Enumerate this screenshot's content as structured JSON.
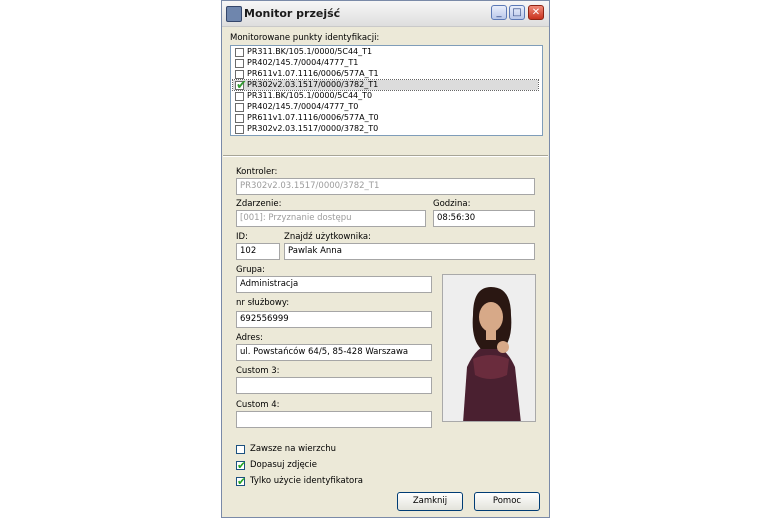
{
  "window": {
    "title": "Monitor przejść"
  },
  "monitored": {
    "label": "Monitorowane punkty identyfikacji:",
    "items": [
      {
        "text": "PR311.BK/105.1/0000/5C44_T1",
        "checked": false,
        "selected": false
      },
      {
        "text": "PR402/145.7/0004/4777_T1",
        "checked": false,
        "selected": false
      },
      {
        "text": "PR611v1.07.1116/0006/577A_T1",
        "checked": false,
        "selected": false
      },
      {
        "text": "PR302v2.03.1517/0000/3782_T1",
        "checked": true,
        "selected": true
      },
      {
        "text": "PR311.BK/105.1/0000/5C44_T0",
        "checked": false,
        "selected": false
      },
      {
        "text": "PR402/145.7/0004/4777_T0",
        "checked": false,
        "selected": false
      },
      {
        "text": "PR611v1.07.1116/0006/577A_T0",
        "checked": false,
        "selected": false
      },
      {
        "text": "PR302v2.03.1517/0000/3782_T0",
        "checked": false,
        "selected": false
      }
    ]
  },
  "details": {
    "kontroler": {
      "label": "Kontroler:",
      "value": "PR302v2.03.1517/0000/3782_T1"
    },
    "zdarzenie": {
      "label": "Zdarzenie:",
      "value": "[001]: Przyznanie dostępu"
    },
    "godzina": {
      "label": "Godzina:",
      "value": "08:56:30"
    },
    "id": {
      "label": "ID:",
      "value": "102"
    },
    "znajdz": {
      "label": "Znajdź użytkownika:",
      "value": "Pawlak Anna"
    },
    "grupa": {
      "label": "Grupa:",
      "value": "Administracja"
    },
    "nr": {
      "label": "nr służbowy:",
      "value": "692556999"
    },
    "adres": {
      "label": "Adres:",
      "value": "ul. Powstańców 64/5, 85-428 Warszawa"
    },
    "custom3": {
      "label": "Custom 3:",
      "value": ""
    },
    "custom4": {
      "label": "Custom 4:",
      "value": ""
    }
  },
  "options": [
    {
      "label": "Zawsze na wierzchu",
      "checked": false
    },
    {
      "label": "Dopasuj zdjęcie",
      "checked": true
    },
    {
      "label": "Tylko użycie identyfikatora",
      "checked": true
    }
  ],
  "buttons": {
    "close": "Zamknij",
    "help": "Pomoc"
  },
  "colors": {
    "check": "#21a121",
    "title_bg": "#f0f0f0",
    "panel_bg": "#ece9d8"
  }
}
